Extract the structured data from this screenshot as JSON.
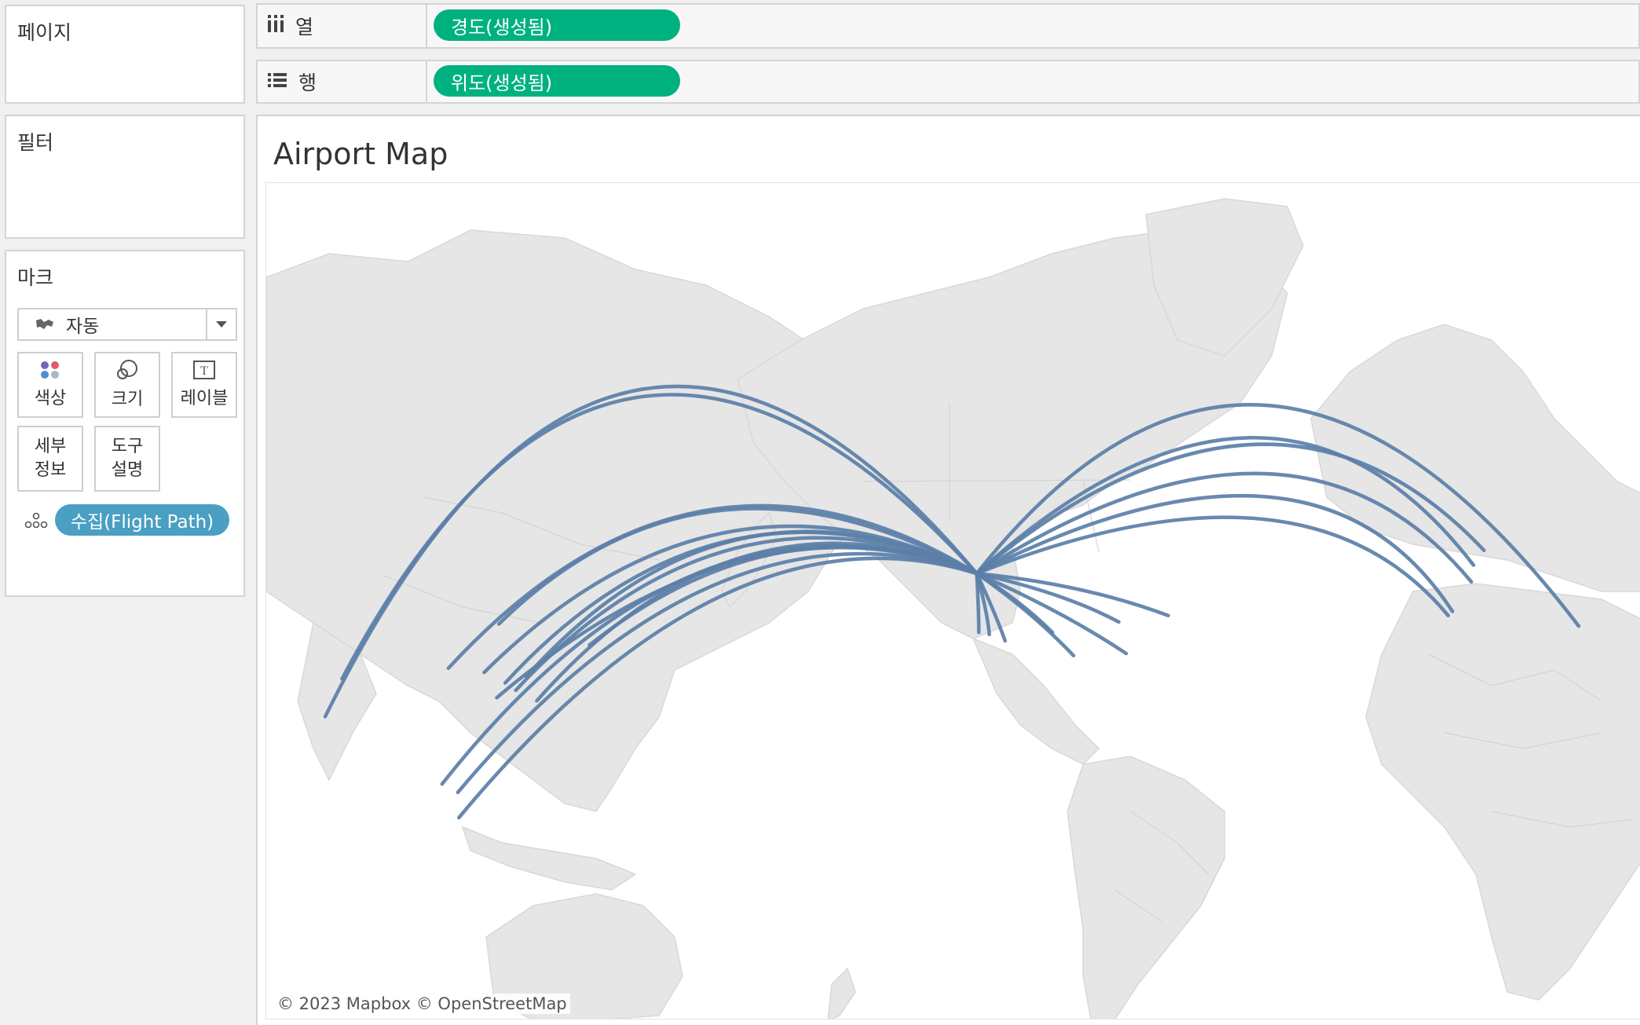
{
  "pages_shelf": {
    "title": "페이지"
  },
  "columns_shelf": {
    "label": "열",
    "icon": "columns-icon",
    "pill": "경도(생성됨)"
  },
  "rows_shelf": {
    "label": "행",
    "icon": "rows-icon",
    "pill": "위도(생성됨)"
  },
  "filters_shelf": {
    "title": "필터"
  },
  "marks": {
    "title": "마크",
    "mark_type": "자동",
    "buttons": {
      "color": "색상",
      "size": "크기",
      "label": "레이블",
      "detail_line1": "세부",
      "detail_line2": "정보",
      "tooltip_line1": "도구",
      "tooltip_line2": "설명"
    },
    "detail_pill": "수집(Flight Path)"
  },
  "view": {
    "title": "Airport Map",
    "attribution": "© 2023 Mapbox © OpenStreetMap"
  },
  "colors": {
    "accent_green": "#00b180",
    "detail_blue": "#4a9fc3",
    "flight_path": "#5b7fa8"
  }
}
